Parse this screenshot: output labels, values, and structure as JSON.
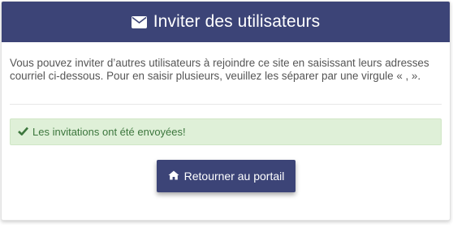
{
  "header": {
    "icon": "envelope-icon",
    "title": "Inviter des utilisateurs"
  },
  "intro": {
    "text": "Vous pouvez inviter d’autres utilisateurs à rejoindre ce site en saisissant leurs adresses courriel ci-dessous. Pour en saisir plusieurs, veuillez les séparer par une virgule « , »."
  },
  "alert": {
    "icon": "checkmark-icon",
    "text": "Les invitations ont été envoyées!"
  },
  "portal_button": {
    "icon": "home-icon",
    "label": "Retourner au portail"
  },
  "colors": {
    "primary": "#3c4477",
    "success_bg": "#dff0d8",
    "success_text": "#3c763d",
    "body_text": "#555555"
  }
}
